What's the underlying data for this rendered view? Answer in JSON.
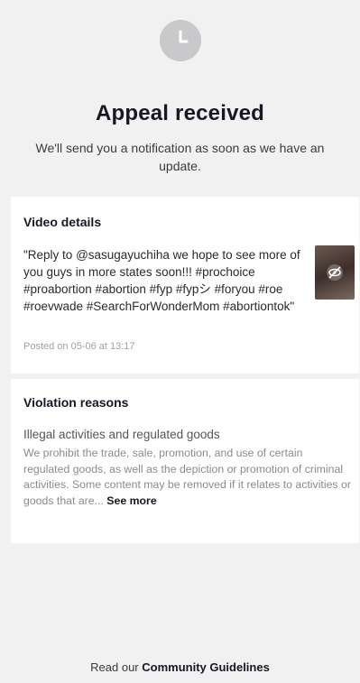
{
  "header": {
    "icon": "clock-icon",
    "title": "Appeal received",
    "subtitle": "We'll send you a notification as soon as we have an update."
  },
  "video_details": {
    "title": "Video details",
    "caption": "\"Reply to @sasugayuchiha we hope to see more of you guys in more states soon!!! #prochoice #proabortion #abortion #fyp #fypシ #foryou #roe #roevwade #SearchForWonderMom #abortiontok\"",
    "posted": "Posted on 05-06 at 13:17",
    "thumbnail_badge_icon": "hidden-eye-icon"
  },
  "violation": {
    "title": "Violation reasons",
    "reason_title": "Illegal activities and regulated goods",
    "reason_text": "We prohibit the trade, sale, promotion, and use of certain regulated goods, as well as the depiction or promotion of criminal activities. Some content may be removed if it relates to activities or goods that are...",
    "see_more": " See more"
  },
  "footer": {
    "prefix": "Read our ",
    "link": "Community Guidelines"
  },
  "colors": {
    "background": "#f1f1f2",
    "card": "#ffffff",
    "icon_gray": "#c9c9cc",
    "text_primary": "#161823",
    "text_muted": "#8a8a92"
  }
}
